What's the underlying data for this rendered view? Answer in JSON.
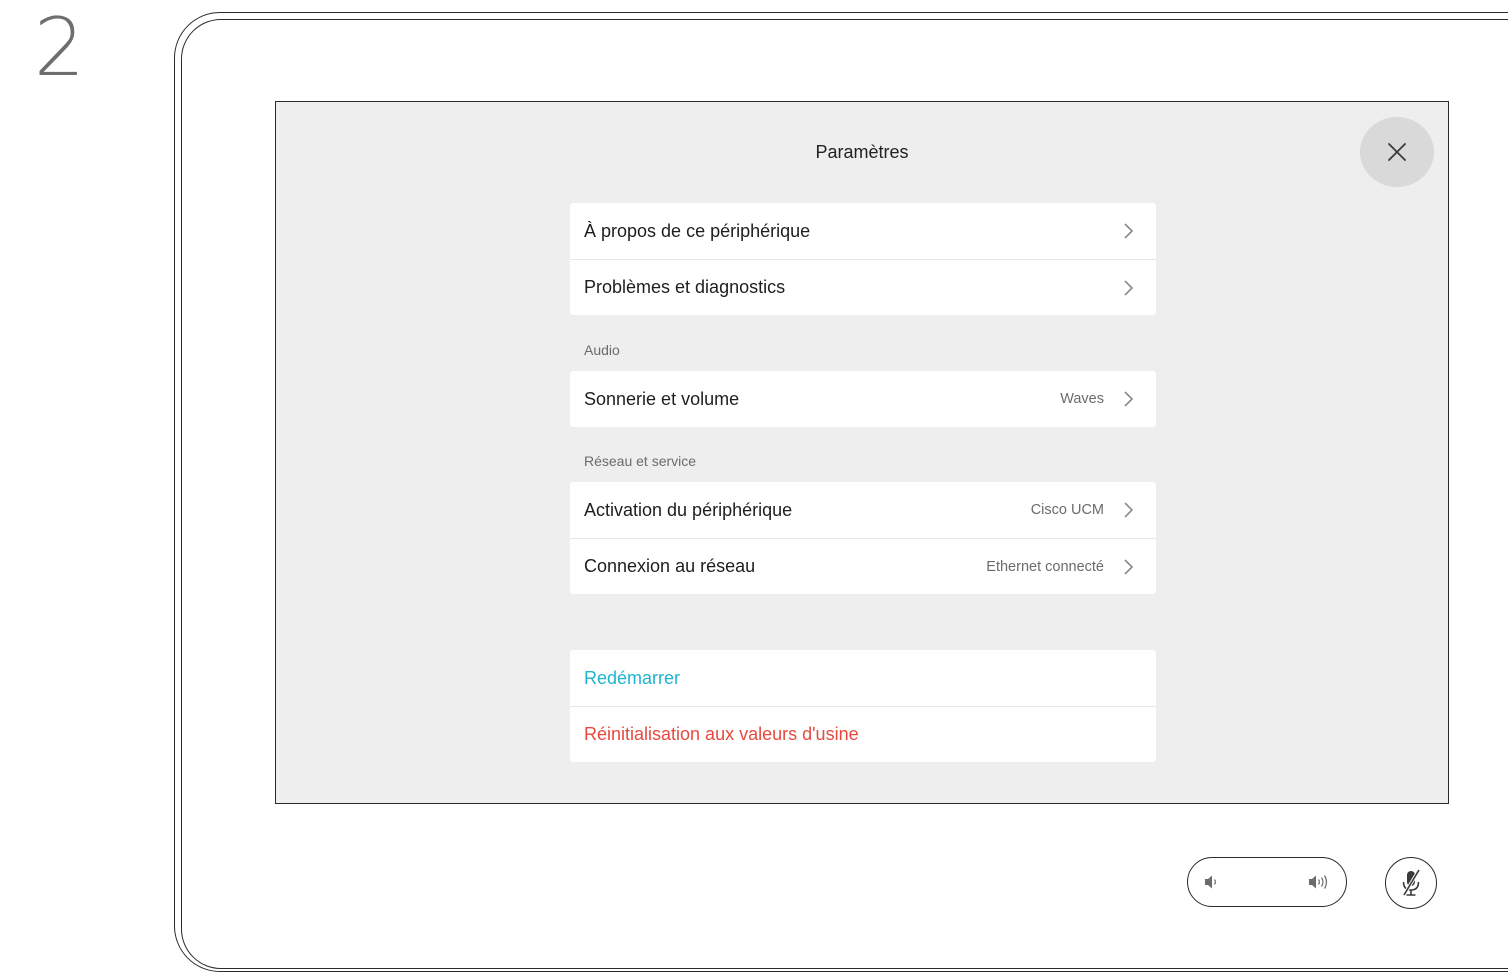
{
  "step": {
    "number": "2"
  },
  "settings": {
    "title": "Paramètres",
    "close_icon": "close-icon",
    "general_items": [
      {
        "label": "À propos de ce périphérique"
      },
      {
        "label": "Problèmes et diagnostics"
      }
    ],
    "audio": {
      "section_label": "Audio",
      "items": [
        {
          "label": "Sonnerie et volume",
          "value": "Waves"
        }
      ]
    },
    "network": {
      "section_label": "Réseau et service",
      "items": [
        {
          "label": "Activation du périphérique",
          "value": "Cisco UCM"
        },
        {
          "label": "Connexion au réseau",
          "value": "Ethernet connecté"
        }
      ]
    },
    "actions": {
      "restart_label": "Redémarrer",
      "factory_reset_label": "Réinitialisation aux valeurs d'usine"
    }
  },
  "controls": {
    "volume_down_icon": "speaker-low-icon",
    "volume_up_icon": "speaker-high-icon",
    "mute_icon": "microphone-muted-icon"
  },
  "colors": {
    "screen_background": "#eeeeee",
    "restart_accent": "#1fb4cf",
    "reset_accent": "#e8493f"
  }
}
